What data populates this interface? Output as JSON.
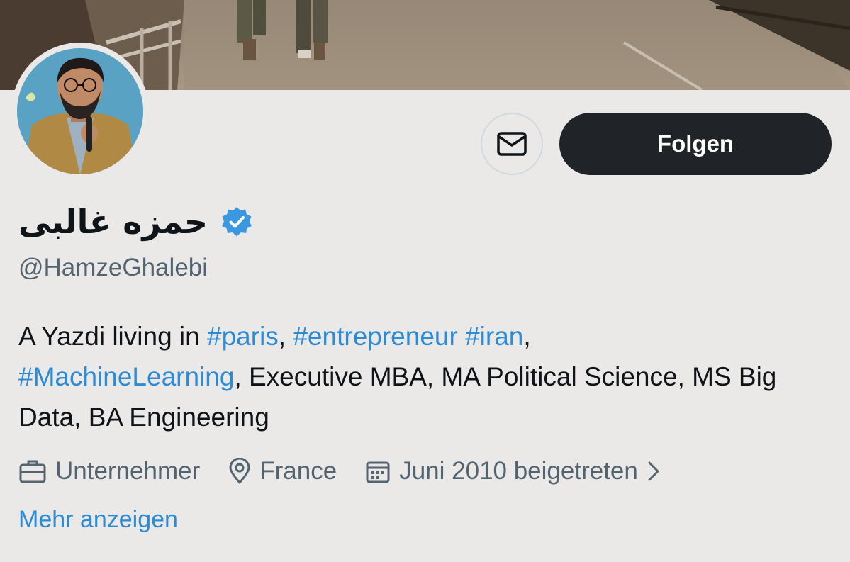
{
  "profile": {
    "display_name": "حمزه غالبی",
    "handle": "@HamzeGhalebi",
    "verified": true
  },
  "actions": {
    "message_icon": "envelope-icon",
    "follow_label": "Folgen"
  },
  "bio": {
    "t1": "A Yazdi living in ",
    "tag_paris": "#paris",
    "t2": ", ",
    "tag_entrepreneur": "#entrepreneur",
    "t3": " ",
    "tag_iran": "#iran",
    "t4": ",",
    "tag_ml": "#MachineLearning",
    "t5": ", Executive MBA, MA Political Science, MS Big Data, BA Engineering"
  },
  "meta": {
    "occupation": "Unternehmer",
    "location": "France",
    "joined": "Juni 2010 beigetreten",
    "icons": [
      "briefcase-icon",
      "location-pin-icon",
      "calendar-icon",
      "chevron-right-icon"
    ]
  },
  "more_label": "Mehr anzeigen",
  "colors": {
    "background": "#ebe9e8",
    "link": "#2b8bd4",
    "follow_button": "#202327",
    "verified_badge": "#3b98e0",
    "secondary_text": "#536471"
  }
}
